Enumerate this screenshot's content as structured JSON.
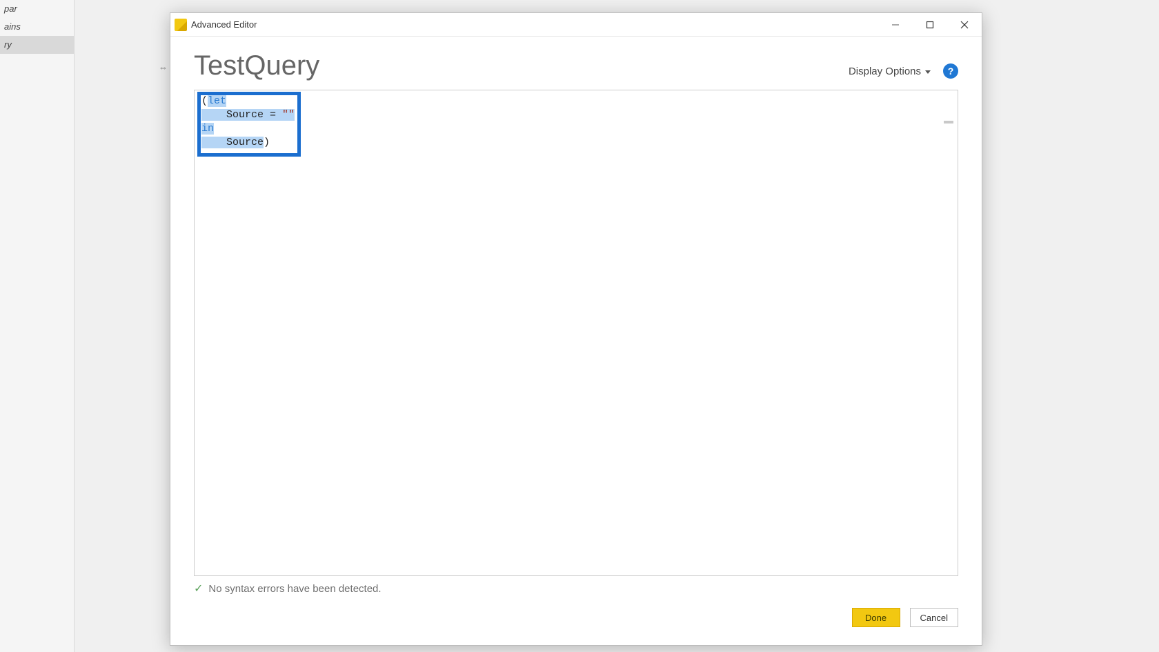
{
  "sidebar": {
    "items": [
      {
        "label": "par"
      },
      {
        "label": "ains"
      },
      {
        "label": "ry"
      }
    ],
    "selected_index": 2
  },
  "dialog": {
    "title": "Advanced Editor",
    "query_name": "TestQuery",
    "display_options_label": "Display Options",
    "code": {
      "line1_open": "(",
      "line1_kw": "let",
      "line2_indent": "    ",
      "line2_var": "Source",
      "line2_eq": " = ",
      "line2_str": "\"\"",
      "line3_kw": "in",
      "line4_indent": "    ",
      "line4_var": "Source",
      "line4_close": ")"
    },
    "status_text": "No syntax errors have been detected.",
    "done_label": "Done",
    "cancel_label": "Cancel",
    "help_glyph": "?"
  }
}
